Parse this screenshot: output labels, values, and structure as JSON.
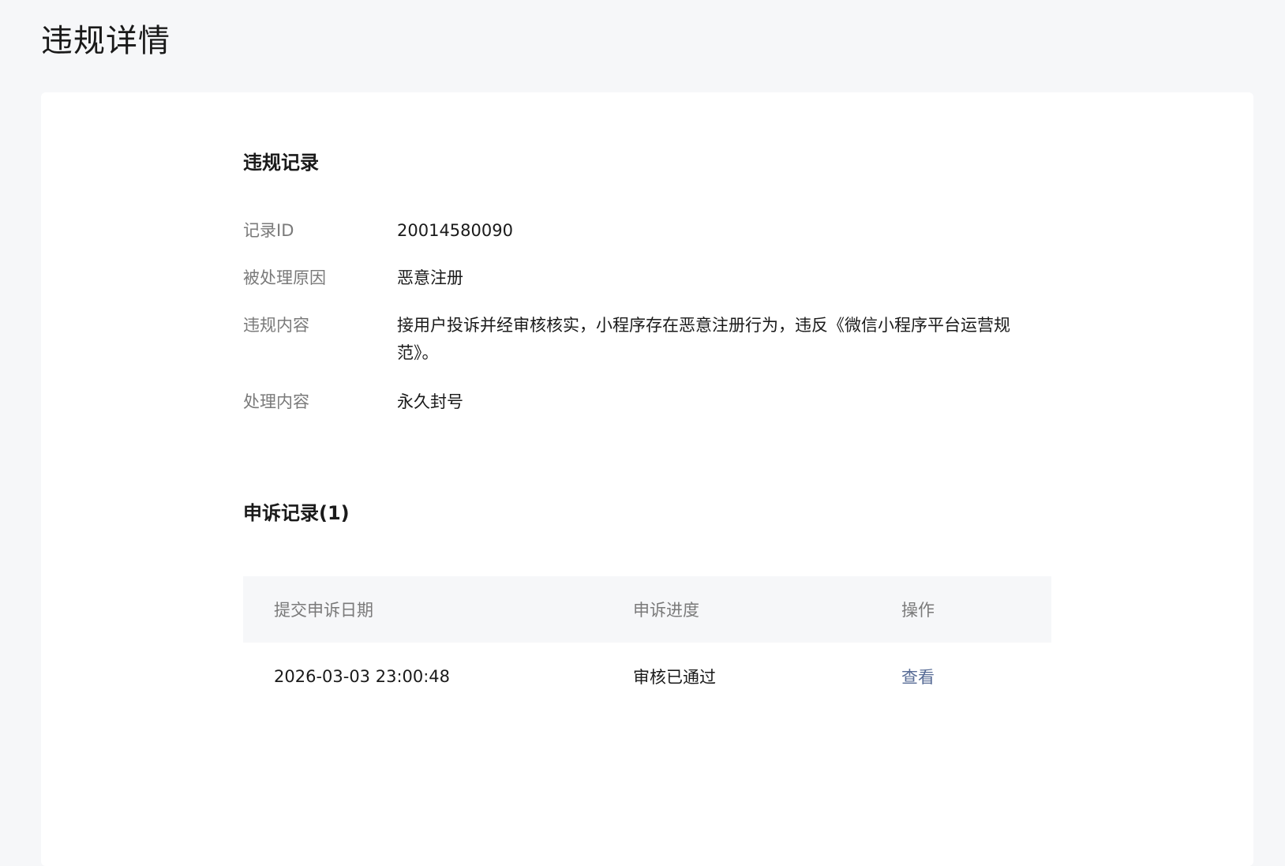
{
  "page": {
    "title": "违规详情"
  },
  "violation": {
    "section_title": "违规记录",
    "fields": [
      {
        "label": "记录ID",
        "value": "20014580090"
      },
      {
        "label": "被处理原因",
        "value": "恶意注册"
      },
      {
        "label": "违规内容",
        "value": "接用户投诉并经审核核实，小程序存在恶意注册行为，违反《微信小程序平台运营规范》。"
      },
      {
        "label": "处理内容",
        "value": "永久封号"
      }
    ]
  },
  "appeals": {
    "section_title": "申诉记录(1)",
    "columns": [
      "提交申诉日期",
      "申诉进度",
      "操作"
    ],
    "rows": [
      {
        "date": "2026-03-03 23:00:48",
        "progress": "审核已通过",
        "action": "查看"
      }
    ]
  },
  "colors": {
    "background": "#f6f7f9",
    "card": "#ffffff",
    "label": "#7a7a7a",
    "text": "#1a1a1a",
    "link": "#576b95"
  }
}
